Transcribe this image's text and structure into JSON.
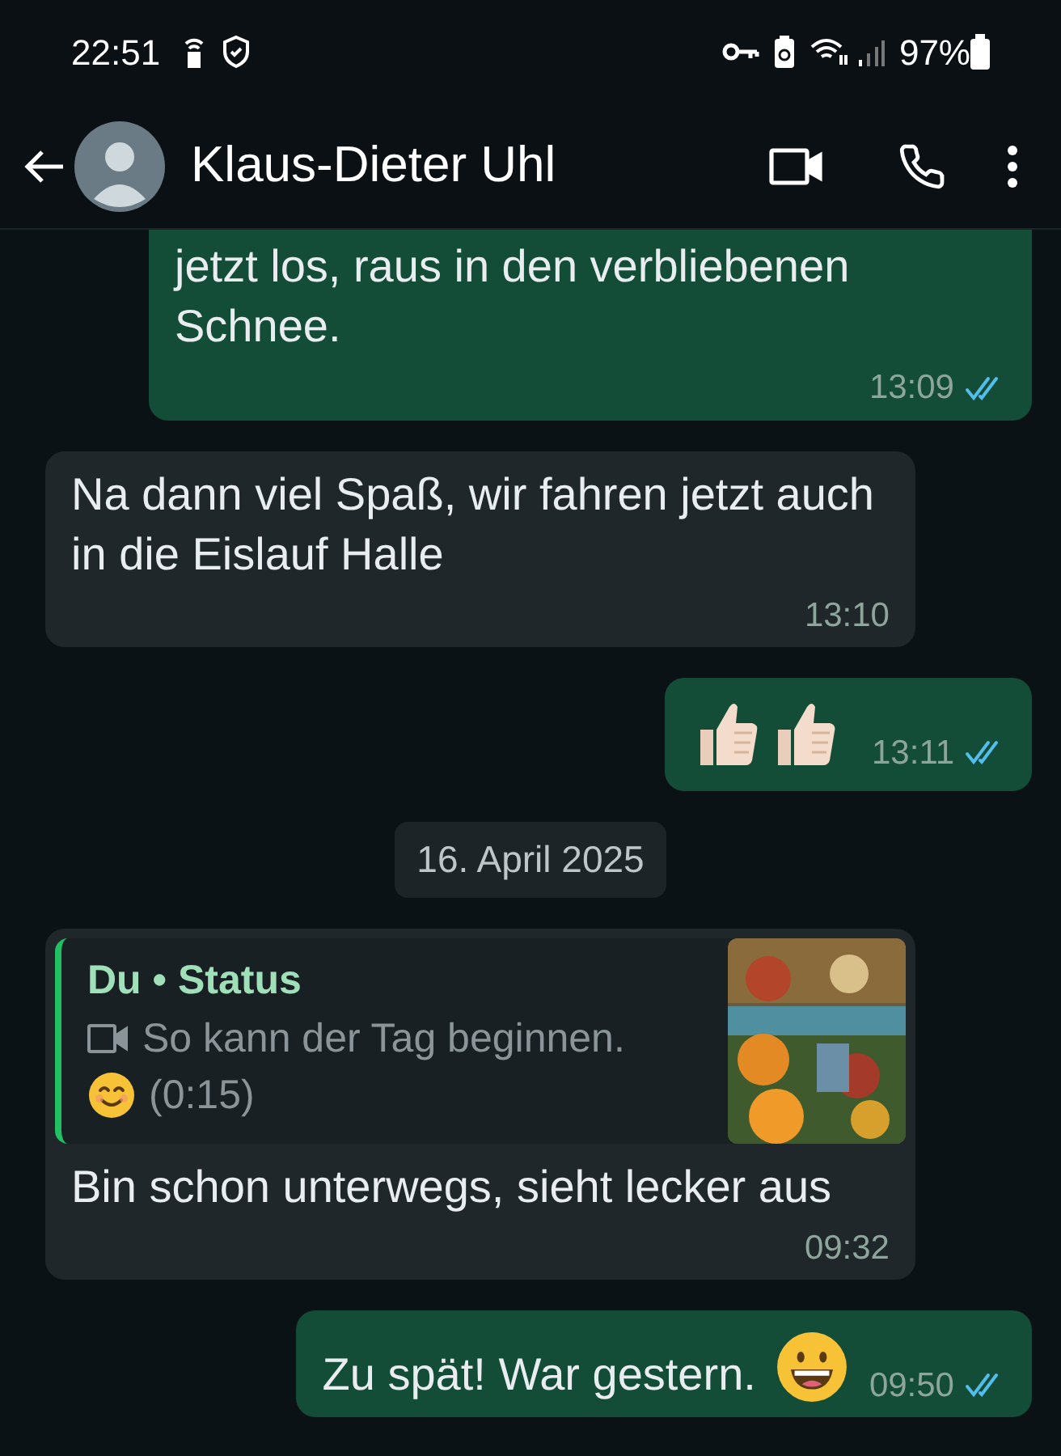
{
  "status_bar": {
    "time": "22:51",
    "battery": "97%"
  },
  "header": {
    "contact": "Klaus-Dieter Uhl"
  },
  "messages": [
    {
      "kind": "out",
      "cut": true,
      "text": "jetzt los, raus in den verbliebenen Schnee.",
      "time": "13:09",
      "read": true
    },
    {
      "kind": "in",
      "text": "Na dann viel Spaß, wir fahren jetzt auch in die Eislauf Halle",
      "time": "13:10"
    },
    {
      "kind": "thumbs",
      "time": "13:11",
      "read": true
    },
    {
      "kind": "date",
      "text": "16. April 2025"
    },
    {
      "kind": "reply",
      "quote": {
        "author": "Du • Status",
        "text": "So kann der Tag beginnen.",
        "emoji": {
          "kind": "smile"
        },
        "duration": "(0:15)"
      },
      "text": "Bin schon unterwegs, sieht lecker aus",
      "time": "09:32"
    },
    {
      "kind": "out",
      "cut": false,
      "text": "Zu spät! War gestern.",
      "emoji": {
        "kind": "grin"
      },
      "time": "09:50",
      "read": true
    }
  ]
}
